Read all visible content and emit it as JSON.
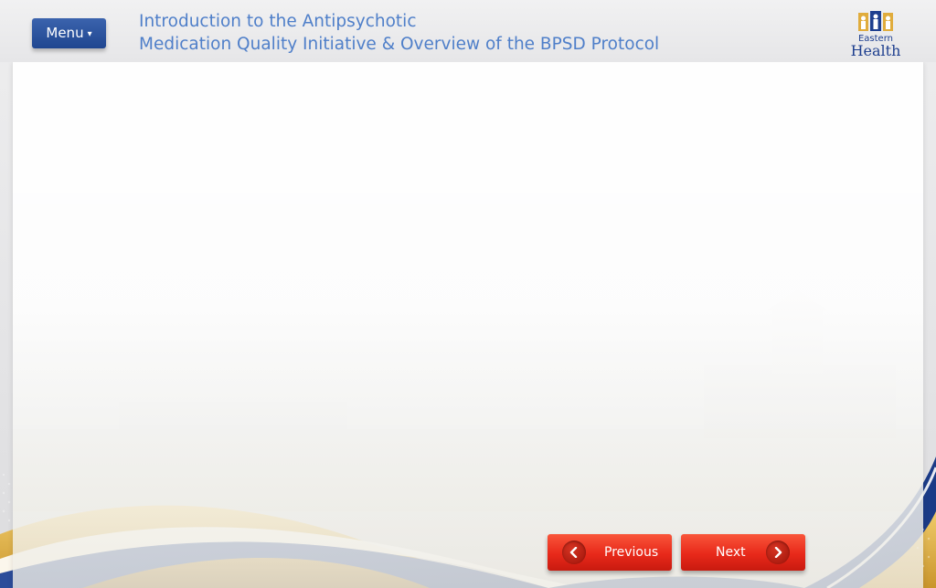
{
  "header": {
    "menu_label": "Menu",
    "menu_caret": "▾",
    "title_line1": "Introduction to the Antipsychotic",
    "title_line2": "Medication Quality Initiative & Overview of the BPSD Protocol"
  },
  "logo": {
    "line1": "Eastern",
    "line2": "Health",
    "icon": "eastern-health-logo"
  },
  "navigation": {
    "previous_label": "Previous",
    "next_label": "Next",
    "previous_icon": "chevron-left-icon",
    "next_icon": "chevron-right-icon"
  },
  "colors": {
    "title": "#4f7fc9",
    "menu_button": "#2a51a0",
    "nav_button": "#e8291a",
    "wave_gold": "#e2b64a",
    "wave_blue": "#1f3f8f"
  }
}
